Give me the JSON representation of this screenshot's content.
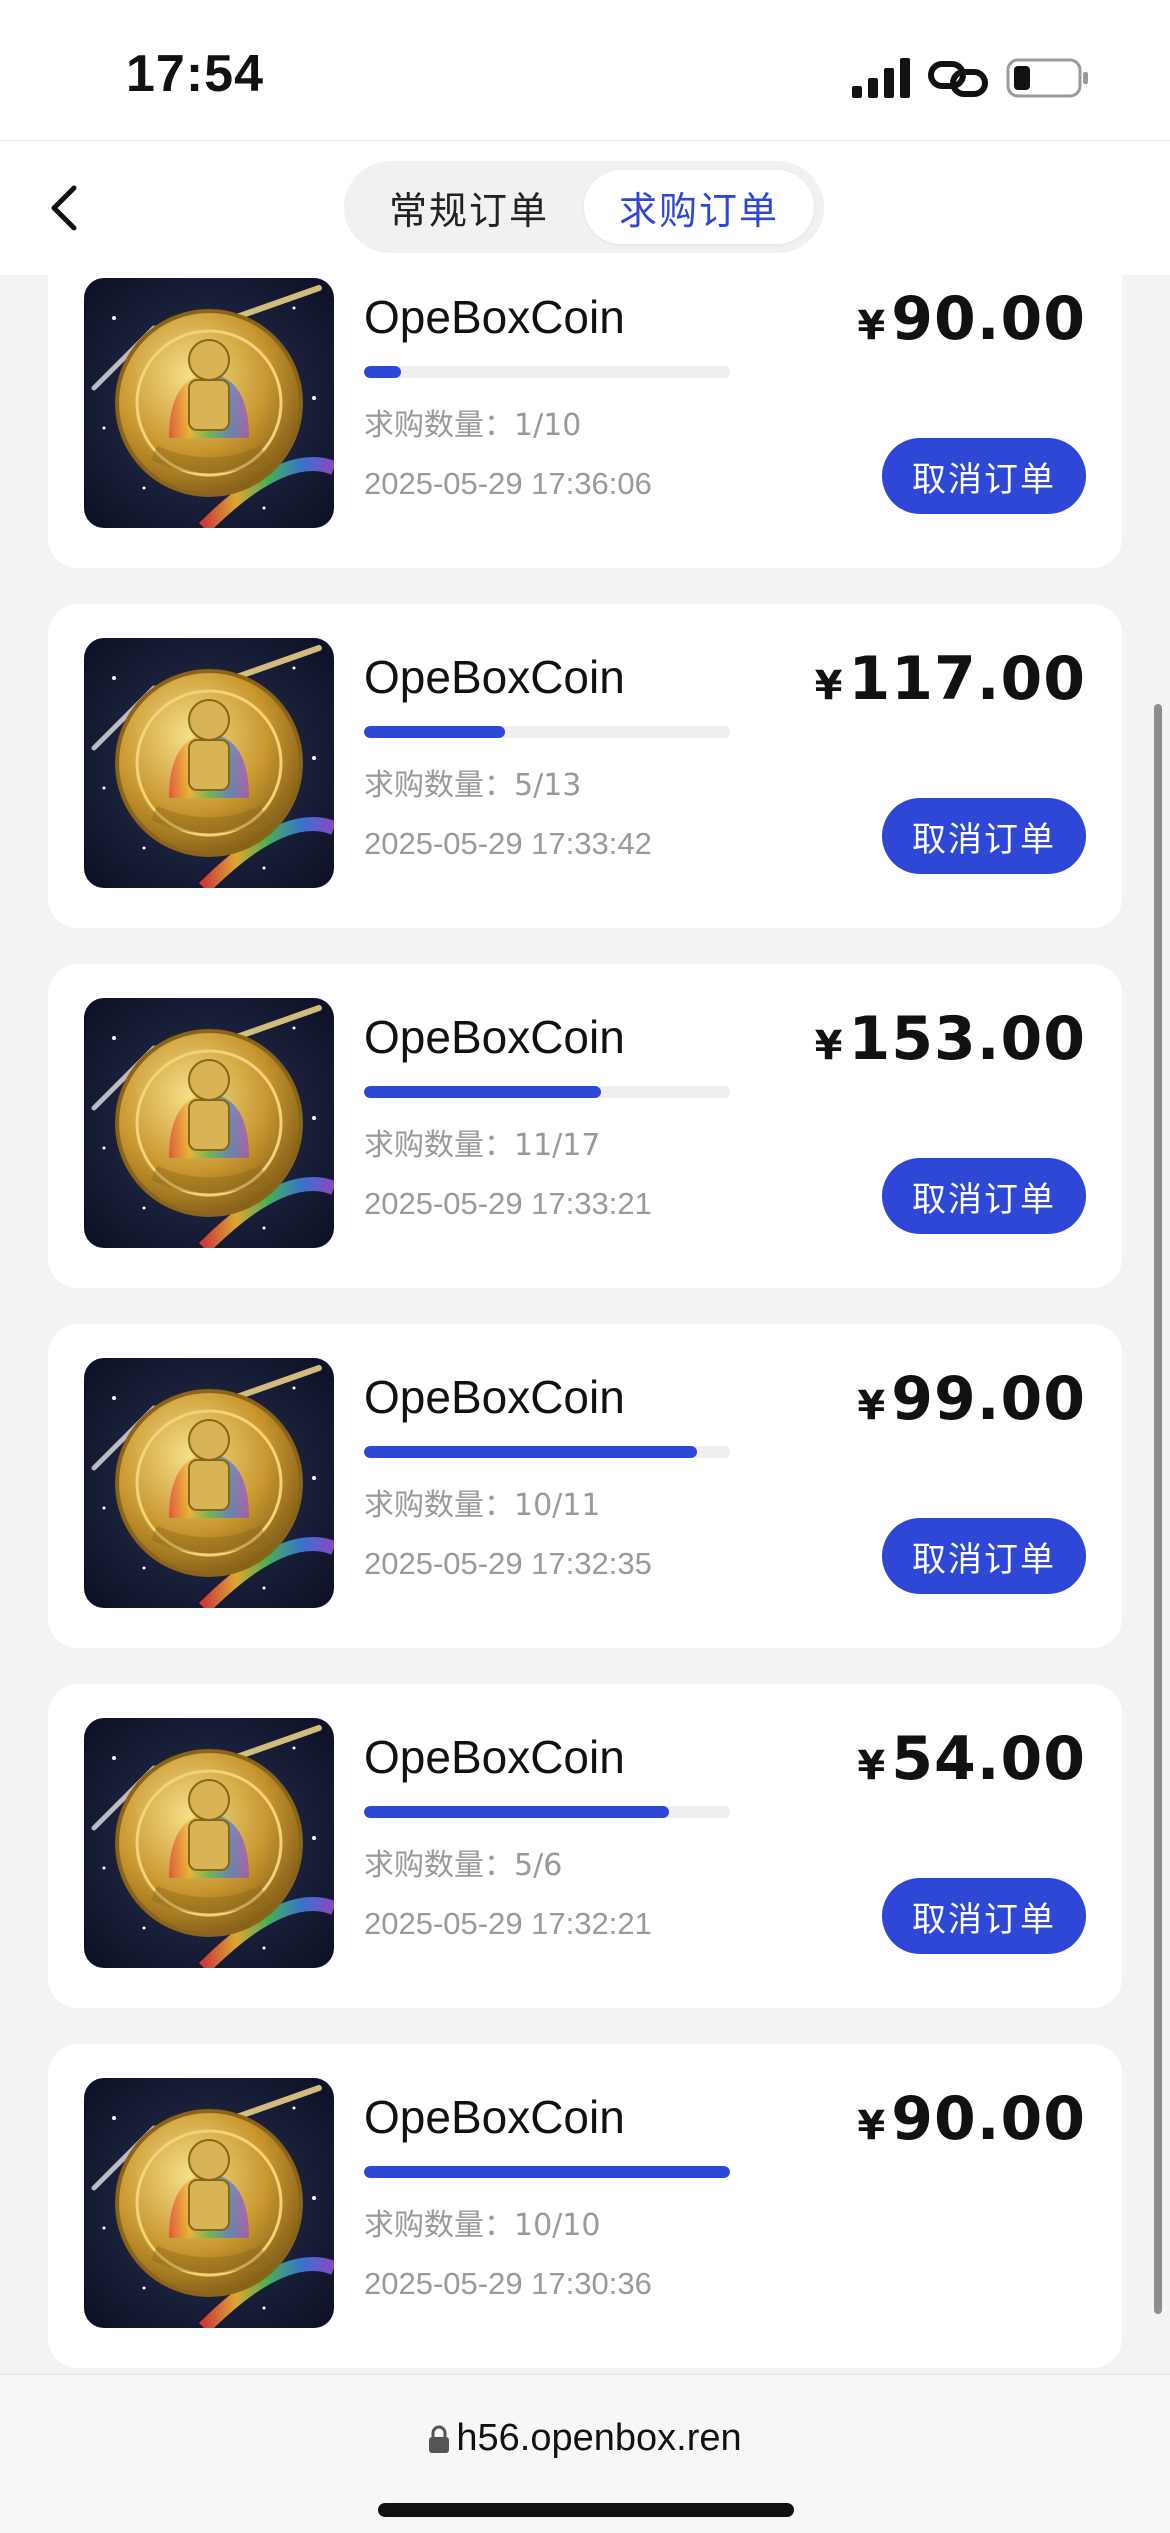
{
  "status_bar": {
    "time": "17:54",
    "icons": [
      "signal-icon",
      "link-icon",
      "battery-icon"
    ]
  },
  "nav": {
    "back_icon": "chevron-left-icon",
    "tabs": [
      {
        "label": "常规订单",
        "active": false
      },
      {
        "label": "求购订单",
        "active": true
      }
    ]
  },
  "orders": [
    {
      "name": "OpeBoxCoin",
      "currency": "¥",
      "price": "90.00",
      "qty_label": "求购数量：1/10",
      "filled": 1,
      "total": 10,
      "time": "2025-05-29 17:36:06",
      "cancel_label": "取消订单",
      "show_cancel": true
    },
    {
      "name": "OpeBoxCoin",
      "currency": "¥",
      "price": "117.00",
      "qty_label": "求购数量：5/13",
      "filled": 5,
      "total": 13,
      "time": "2025-05-29 17:33:42",
      "cancel_label": "取消订单",
      "show_cancel": true
    },
    {
      "name": "OpeBoxCoin",
      "currency": "¥",
      "price": "153.00",
      "qty_label": "求购数量：11/17",
      "filled": 11,
      "total": 17,
      "time": "2025-05-29 17:33:21",
      "cancel_label": "取消订单",
      "show_cancel": true
    },
    {
      "name": "OpeBoxCoin",
      "currency": "¥",
      "price": "99.00",
      "qty_label": "求购数量：10/11",
      "filled": 10,
      "total": 11,
      "time": "2025-05-29 17:32:35",
      "cancel_label": "取消订单",
      "show_cancel": true
    },
    {
      "name": "OpeBoxCoin",
      "currency": "¥",
      "price": "54.00",
      "qty_label": "求购数量：5/6",
      "filled": 5,
      "total": 6,
      "time": "2025-05-29 17:32:21",
      "cancel_label": "取消订单",
      "show_cancel": true
    },
    {
      "name": "OpeBoxCoin",
      "currency": "¥",
      "price": "90.00",
      "qty_label": "求购数量：10/10",
      "filled": 10,
      "total": 10,
      "time": "2025-05-29 17:30:36",
      "cancel_label": "",
      "show_cancel": false
    }
  ],
  "url_bar": {
    "url": "h56.openbox.ren",
    "icon": "lock-icon"
  },
  "colors": {
    "accent": "#2f47d6",
    "muted_text": "#9a9a9a",
    "background": "#f3f3f4"
  }
}
